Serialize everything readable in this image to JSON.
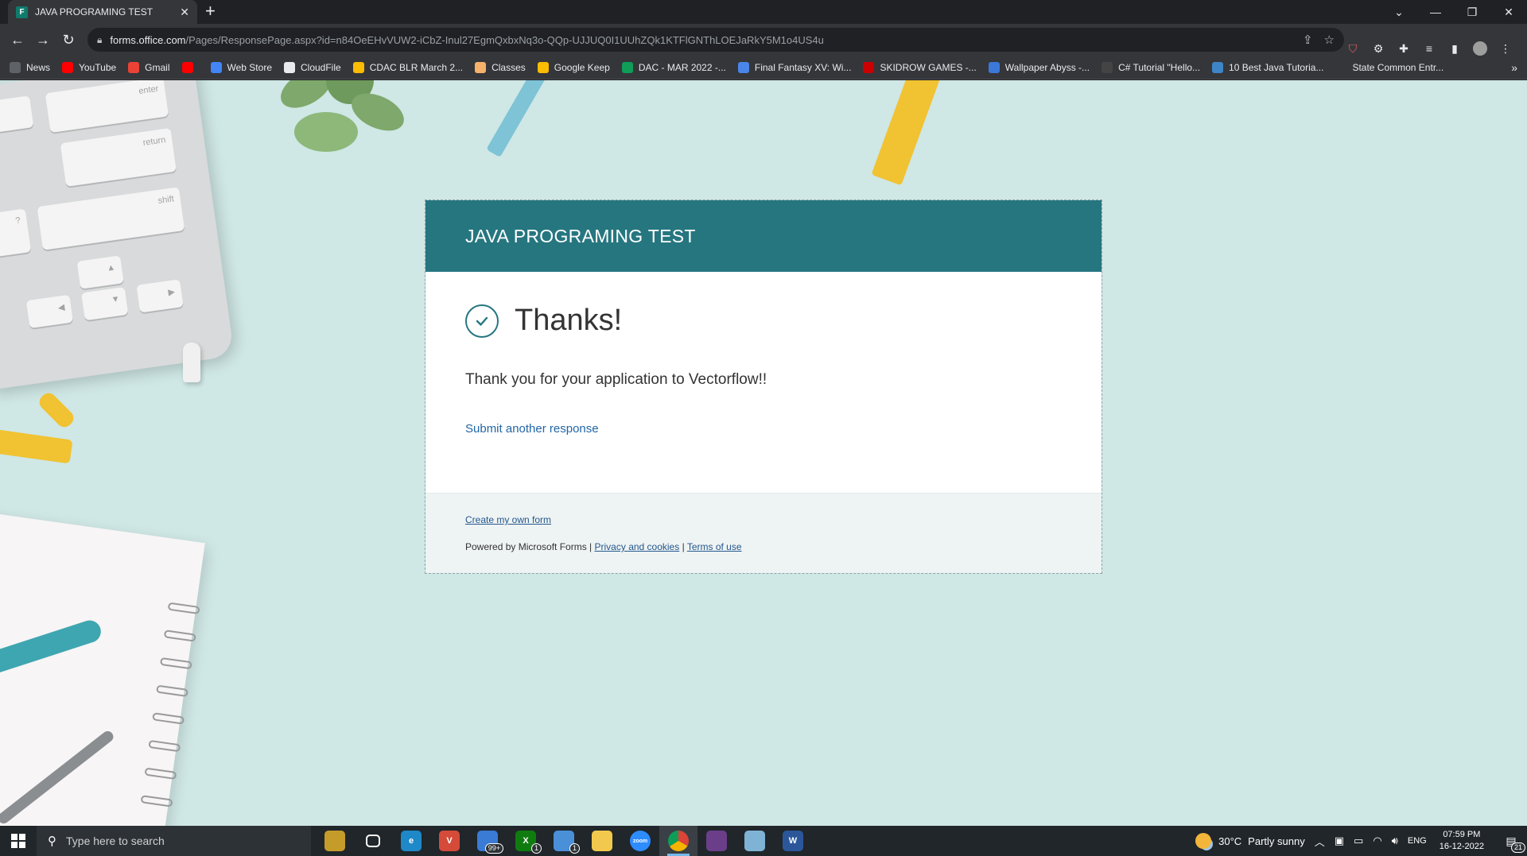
{
  "browser": {
    "tab_title": "JAVA PROGRAMING TEST",
    "tab_favicon_letter": "F",
    "url_host": "forms.office.com",
    "url_path": "/Pages/ResponsePage.aspx?id=n84OeEHvVUW2-iCbZ-Inul27EgmQxbxNq3o-QQp-UJJUQ0I1UUhZQk1KTFlGNThLOEJaRkY5M1o4US4u",
    "bookmarks": [
      {
        "label": "News",
        "icon": "news-icon",
        "color": "#5f6368"
      },
      {
        "label": "YouTube",
        "icon": "youtube-icon",
        "color": "#ff0000"
      },
      {
        "label": "Gmail",
        "icon": "gmail-icon",
        "color": "#ea4335"
      },
      {
        "label": "",
        "icon": "youtube-icon",
        "color": "#ff0000"
      },
      {
        "label": "Web Store",
        "icon": "web-store-icon",
        "color": "#4285f4"
      },
      {
        "label": "CloudFile",
        "icon": "cloud-icon",
        "color": "#e8eaed"
      },
      {
        "label": "CDAC BLR March 2...",
        "icon": "drive-icon",
        "color": "#fbbc04"
      },
      {
        "label": "Classes",
        "icon": "classroom-icon",
        "color": "#f6b26b"
      },
      {
        "label": "Google Keep",
        "icon": "keep-icon",
        "color": "#fbbc04"
      },
      {
        "label": "DAC - MAR 2022 -...",
        "icon": "sheets-icon",
        "color": "#0f9d58"
      },
      {
        "label": "Final Fantasy XV: Wi...",
        "icon": "wiki-icon",
        "color": "#4a86e8"
      },
      {
        "label": "SKIDROW GAMES -...",
        "icon": "skull-icon",
        "color": "#cc0000"
      },
      {
        "label": "Wallpaper Abyss -...",
        "icon": "wallpaper-icon",
        "color": "#3c78d8"
      },
      {
        "label": "C# Tutorial \"Hello...",
        "icon": "hat-icon",
        "color": "#444444"
      },
      {
        "label": "10 Best Java Tutoria...",
        "icon": "dd-icon",
        "color": "#3d85c6"
      },
      {
        "label": "State Common Entr...",
        "icon": "page-icon",
        "color": "#35363a"
      }
    ]
  },
  "form": {
    "title": "JAVA PROGRAMING TEST",
    "heading": "Thanks!",
    "message": "Thank you for your application to Vectorflow!!",
    "another_link": "Submit another response",
    "create_link": "Create my own form",
    "powered_by": "Powered by Microsoft Forms |",
    "privacy_link": "Privacy and cookies",
    "separator": "|",
    "terms_link": "Terms of use",
    "accent_color": "#267680"
  },
  "taskbar": {
    "search_placeholder": "Type here to search",
    "apps": [
      {
        "name": "widgets-app",
        "label": "",
        "color": "#c59b2a",
        "badge": ""
      },
      {
        "name": "task-view-app",
        "label": "",
        "color": "#20262a",
        "badge": ""
      },
      {
        "name": "edge-app",
        "label": "e",
        "color": "#1e88c8",
        "badge": ""
      },
      {
        "name": "vivaldi-app",
        "label": "V",
        "color": "#d44b3a",
        "badge": ""
      },
      {
        "name": "mail-app",
        "label": "",
        "color": "#3a7bd5",
        "badge": "99+"
      },
      {
        "name": "xbox-app",
        "label": "X",
        "color": "#107c10",
        "badge": "1"
      },
      {
        "name": "store-app",
        "label": "",
        "color": "#4a90d9",
        "badge": "1"
      },
      {
        "name": "explorer-app",
        "label": "",
        "color": "#f2c94c",
        "badge": ""
      },
      {
        "name": "zoom-app",
        "label": "zoom",
        "color": "#2d8cff",
        "badge": ""
      },
      {
        "name": "chrome-app",
        "label": "",
        "color": "#db4437",
        "badge": "",
        "active": true
      },
      {
        "name": "game-app",
        "label": "",
        "color": "#6b3e8a",
        "badge": ""
      },
      {
        "name": "notes-app",
        "label": "",
        "color": "#7fb3d5",
        "badge": ""
      },
      {
        "name": "word-app",
        "label": "W",
        "color": "#2b579a",
        "badge": ""
      }
    ],
    "weather_temp": "30°C",
    "weather_desc": "Partly sunny",
    "language": "ENG",
    "time": "07:59 PM",
    "date": "16-12-2022",
    "notification_count": "21"
  }
}
